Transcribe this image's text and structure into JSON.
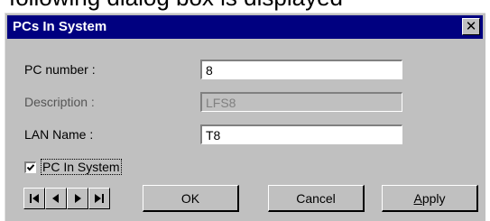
{
  "background_caption": "following dialog box is displayed",
  "dialog": {
    "title": "PCs In System",
    "fields": {
      "pc_number": {
        "label": "PC number :",
        "value": "8"
      },
      "description": {
        "label": "Description :",
        "value": "LFS8"
      },
      "lan_name": {
        "label": "LAN Name :",
        "value": "T8"
      }
    },
    "pc_in_system": {
      "label": "PC In System",
      "checked": true
    },
    "buttons": {
      "ok": "OK",
      "cancel": "Cancel",
      "apply_mnemonic": "A",
      "apply_rest": "pply"
    },
    "nav_icons": [
      "first-record-icon",
      "previous-record-icon",
      "next-record-icon",
      "last-record-icon"
    ]
  },
  "colors": {
    "face": "#c0c0c0",
    "titlebar": "#000080",
    "disabled_text": "#808080"
  }
}
